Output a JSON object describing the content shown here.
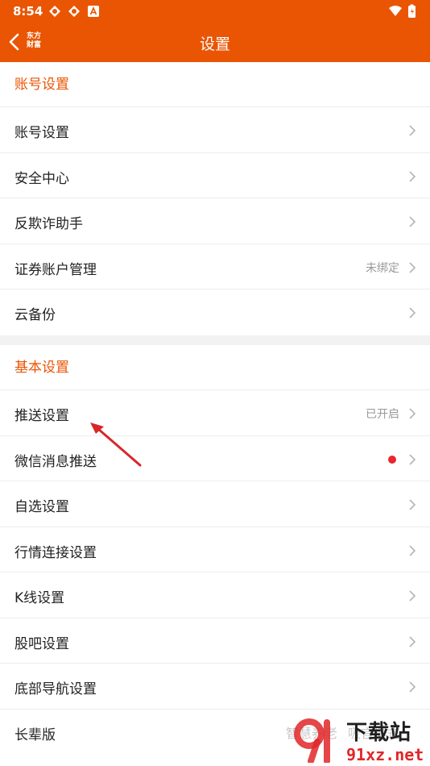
{
  "status_bar": {
    "time": "8:54"
  },
  "nav": {
    "logo_line1": "东方",
    "logo_line2": "财富",
    "title": "设置"
  },
  "sections": [
    {
      "title": "账号设置",
      "rows": [
        {
          "label": "账号设置",
          "value": ""
        },
        {
          "label": "安全中心",
          "value": ""
        },
        {
          "label": "反欺诈助手",
          "value": ""
        },
        {
          "label": "证券账户管理",
          "value": "未绑定"
        },
        {
          "label": "云备份",
          "value": ""
        }
      ]
    },
    {
      "title": "基本设置",
      "rows": [
        {
          "label": "推送设置",
          "value": "已开启"
        },
        {
          "label": "微信消息推送",
          "value": ""
        },
        {
          "label": "自选设置",
          "value": ""
        },
        {
          "label": "行情连接设置",
          "value": ""
        },
        {
          "label": "K线设置",
          "value": ""
        },
        {
          "label": "股吧设置",
          "value": ""
        },
        {
          "label": "底部导航设置",
          "value": ""
        },
        {
          "label": "长辈版",
          "value": ""
        }
      ]
    }
  ],
  "watermark": {
    "text1": "智慧养老",
    "text2": "吸言模式",
    "brand": "下载站",
    "url": "91xz.net"
  },
  "colors": {
    "accent": "#ea5504",
    "red_dot": "#e8262d"
  }
}
